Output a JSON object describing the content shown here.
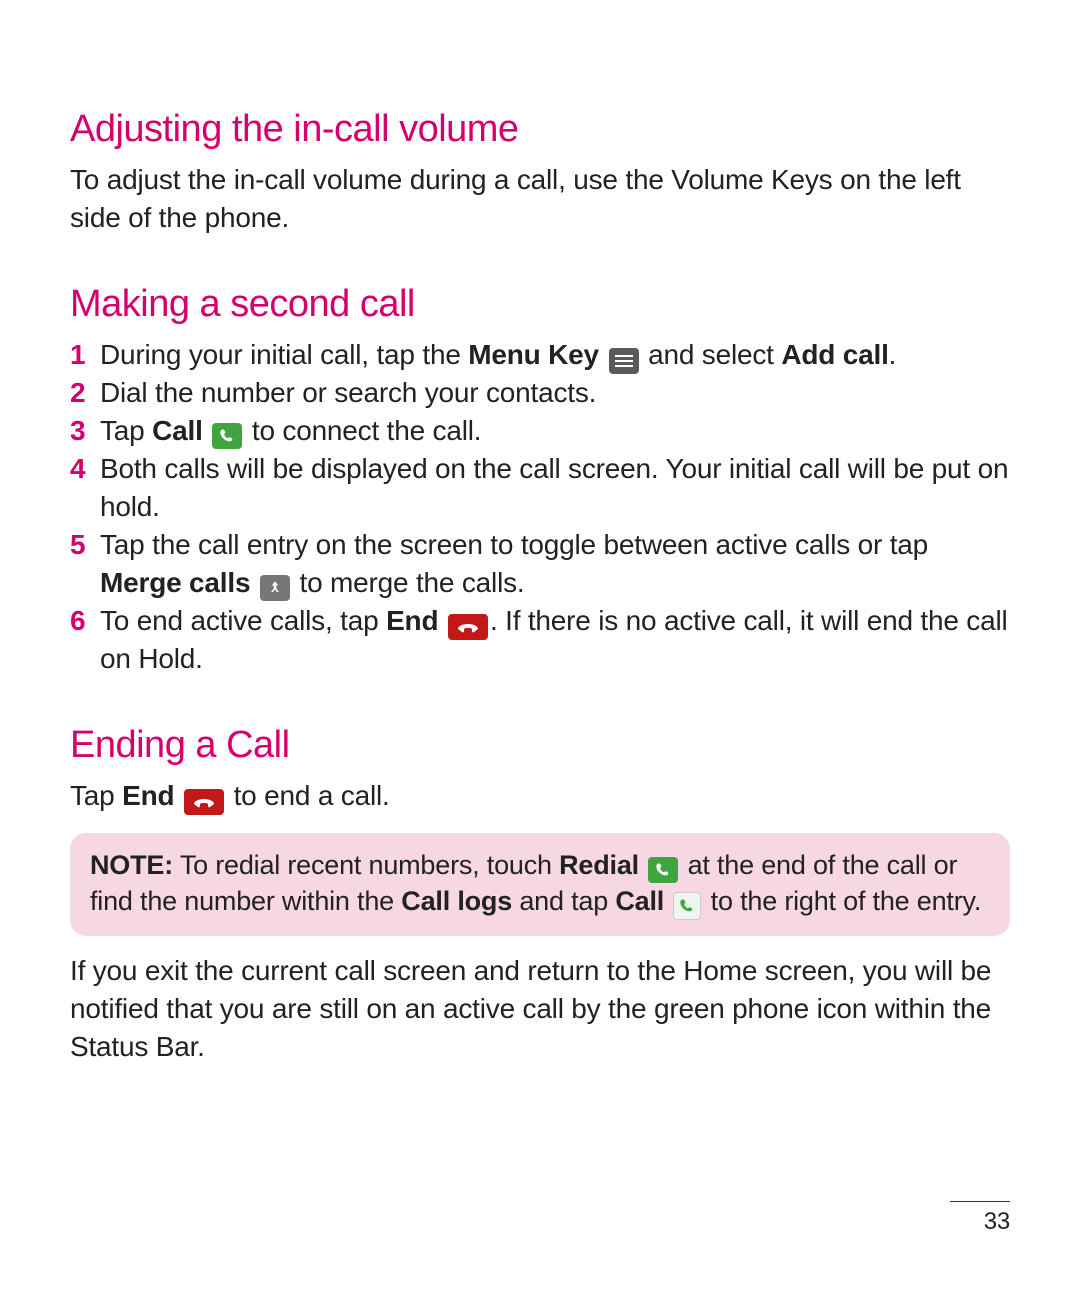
{
  "section1": {
    "heading": "Adjusting the in-call volume",
    "body": "To adjust the in-call volume during a call, use the Volume Keys on the left side of the phone."
  },
  "section2": {
    "heading": "Making a second call",
    "steps": [
      {
        "n": "1",
        "a": "During your initial call, tap the ",
        "b": "Menu Key",
        "c": " and select ",
        "d": "Add call",
        "e": "."
      },
      {
        "n": "2",
        "a": "Dial the number or search your contacts."
      },
      {
        "n": "3",
        "a": "Tap ",
        "b": "Call",
        "c": " to connect the call."
      },
      {
        "n": "4",
        "a": "Both calls will be displayed on the call screen. Your initial call will be put on hold."
      },
      {
        "n": "5",
        "a": "Tap the call entry on the screen to toggle between active calls or tap ",
        "b": "Merge calls",
        "c": " to merge the calls."
      },
      {
        "n": "6",
        "a": "To end active calls, tap ",
        "b": "End",
        "c": ". If there is no active call, it will end the call on Hold."
      }
    ]
  },
  "section3": {
    "heading": "Ending a Call",
    "line_a": "Tap ",
    "line_b": "End",
    "line_c": " to end a call.",
    "note_a": "NOTE:",
    "note_b": " To redial recent numbers, touch ",
    "note_c": "Redial",
    "note_d": " at the end of the call or find the number within the ",
    "note_e": "Call logs",
    "note_f": " and tap ",
    "note_g": "Call",
    "note_h": " to the right of the entry.",
    "after": "If you exit the current call screen and return to the Home screen, you will be notified that you are still on an active call by the green phone icon within the Status Bar."
  },
  "page_number": "33"
}
